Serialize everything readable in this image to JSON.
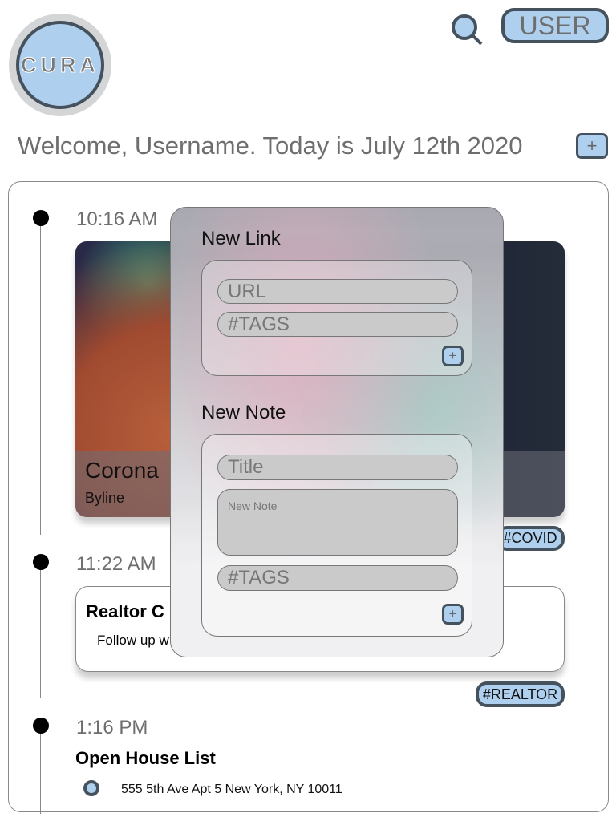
{
  "logo": {
    "text": "CURA"
  },
  "header": {
    "user_label": "USER",
    "welcome": "Welcome, Username. Today is July 12th 2020",
    "add_label": "+"
  },
  "colors": {
    "accent": "#aed0ee",
    "border": "#45525d",
    "text_muted": "#6e6e6e"
  },
  "feed": [
    {
      "time": "10:16 AM",
      "title": "Corona",
      "byline": "Byline",
      "tag": "#COVID"
    },
    {
      "time": "11:22 AM",
      "title": "Realtor C",
      "body": "Follow up w",
      "tag": "#REALTOR"
    },
    {
      "time": "1:16 PM",
      "title": "Open House List",
      "items": [
        "555 5th Ave Apt 5 New York, NY 10011"
      ]
    }
  ],
  "modal": {
    "link": {
      "heading": "New Link",
      "url_placeholder": "URL",
      "tags_placeholder": "#TAGS",
      "add": "+"
    },
    "note": {
      "heading": "New Note",
      "title_placeholder": "Title",
      "note_placeholder": "New Note",
      "tags_placeholder": "#TAGS",
      "add": "+"
    }
  }
}
